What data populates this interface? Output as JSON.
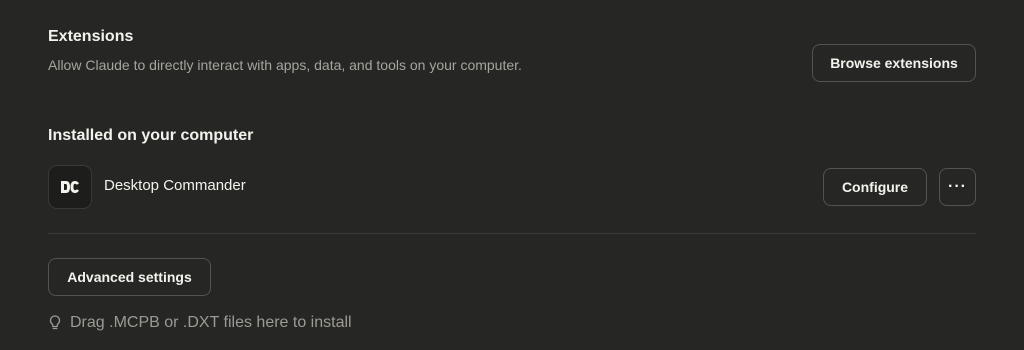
{
  "extensions": {
    "title": "Extensions",
    "description": "Allow Claude to directly interact with apps, data, and tools on your computer.",
    "browse_label": "Browse extensions"
  },
  "installed": {
    "title": "Installed on your computer",
    "items": [
      {
        "name": "Desktop Commander",
        "icon_text": "DC",
        "configure_label": "Configure",
        "more_label": "···"
      }
    ]
  },
  "advanced": {
    "label": "Advanced settings"
  },
  "dropzone": {
    "hint": "Drag .MCPB or .DXT files here to install",
    "icon": "lightbulb-icon"
  },
  "colors": {
    "background": "#262624",
    "text": "#f3f2ec",
    "muted": "#a6a49d",
    "border": "#55534d"
  }
}
